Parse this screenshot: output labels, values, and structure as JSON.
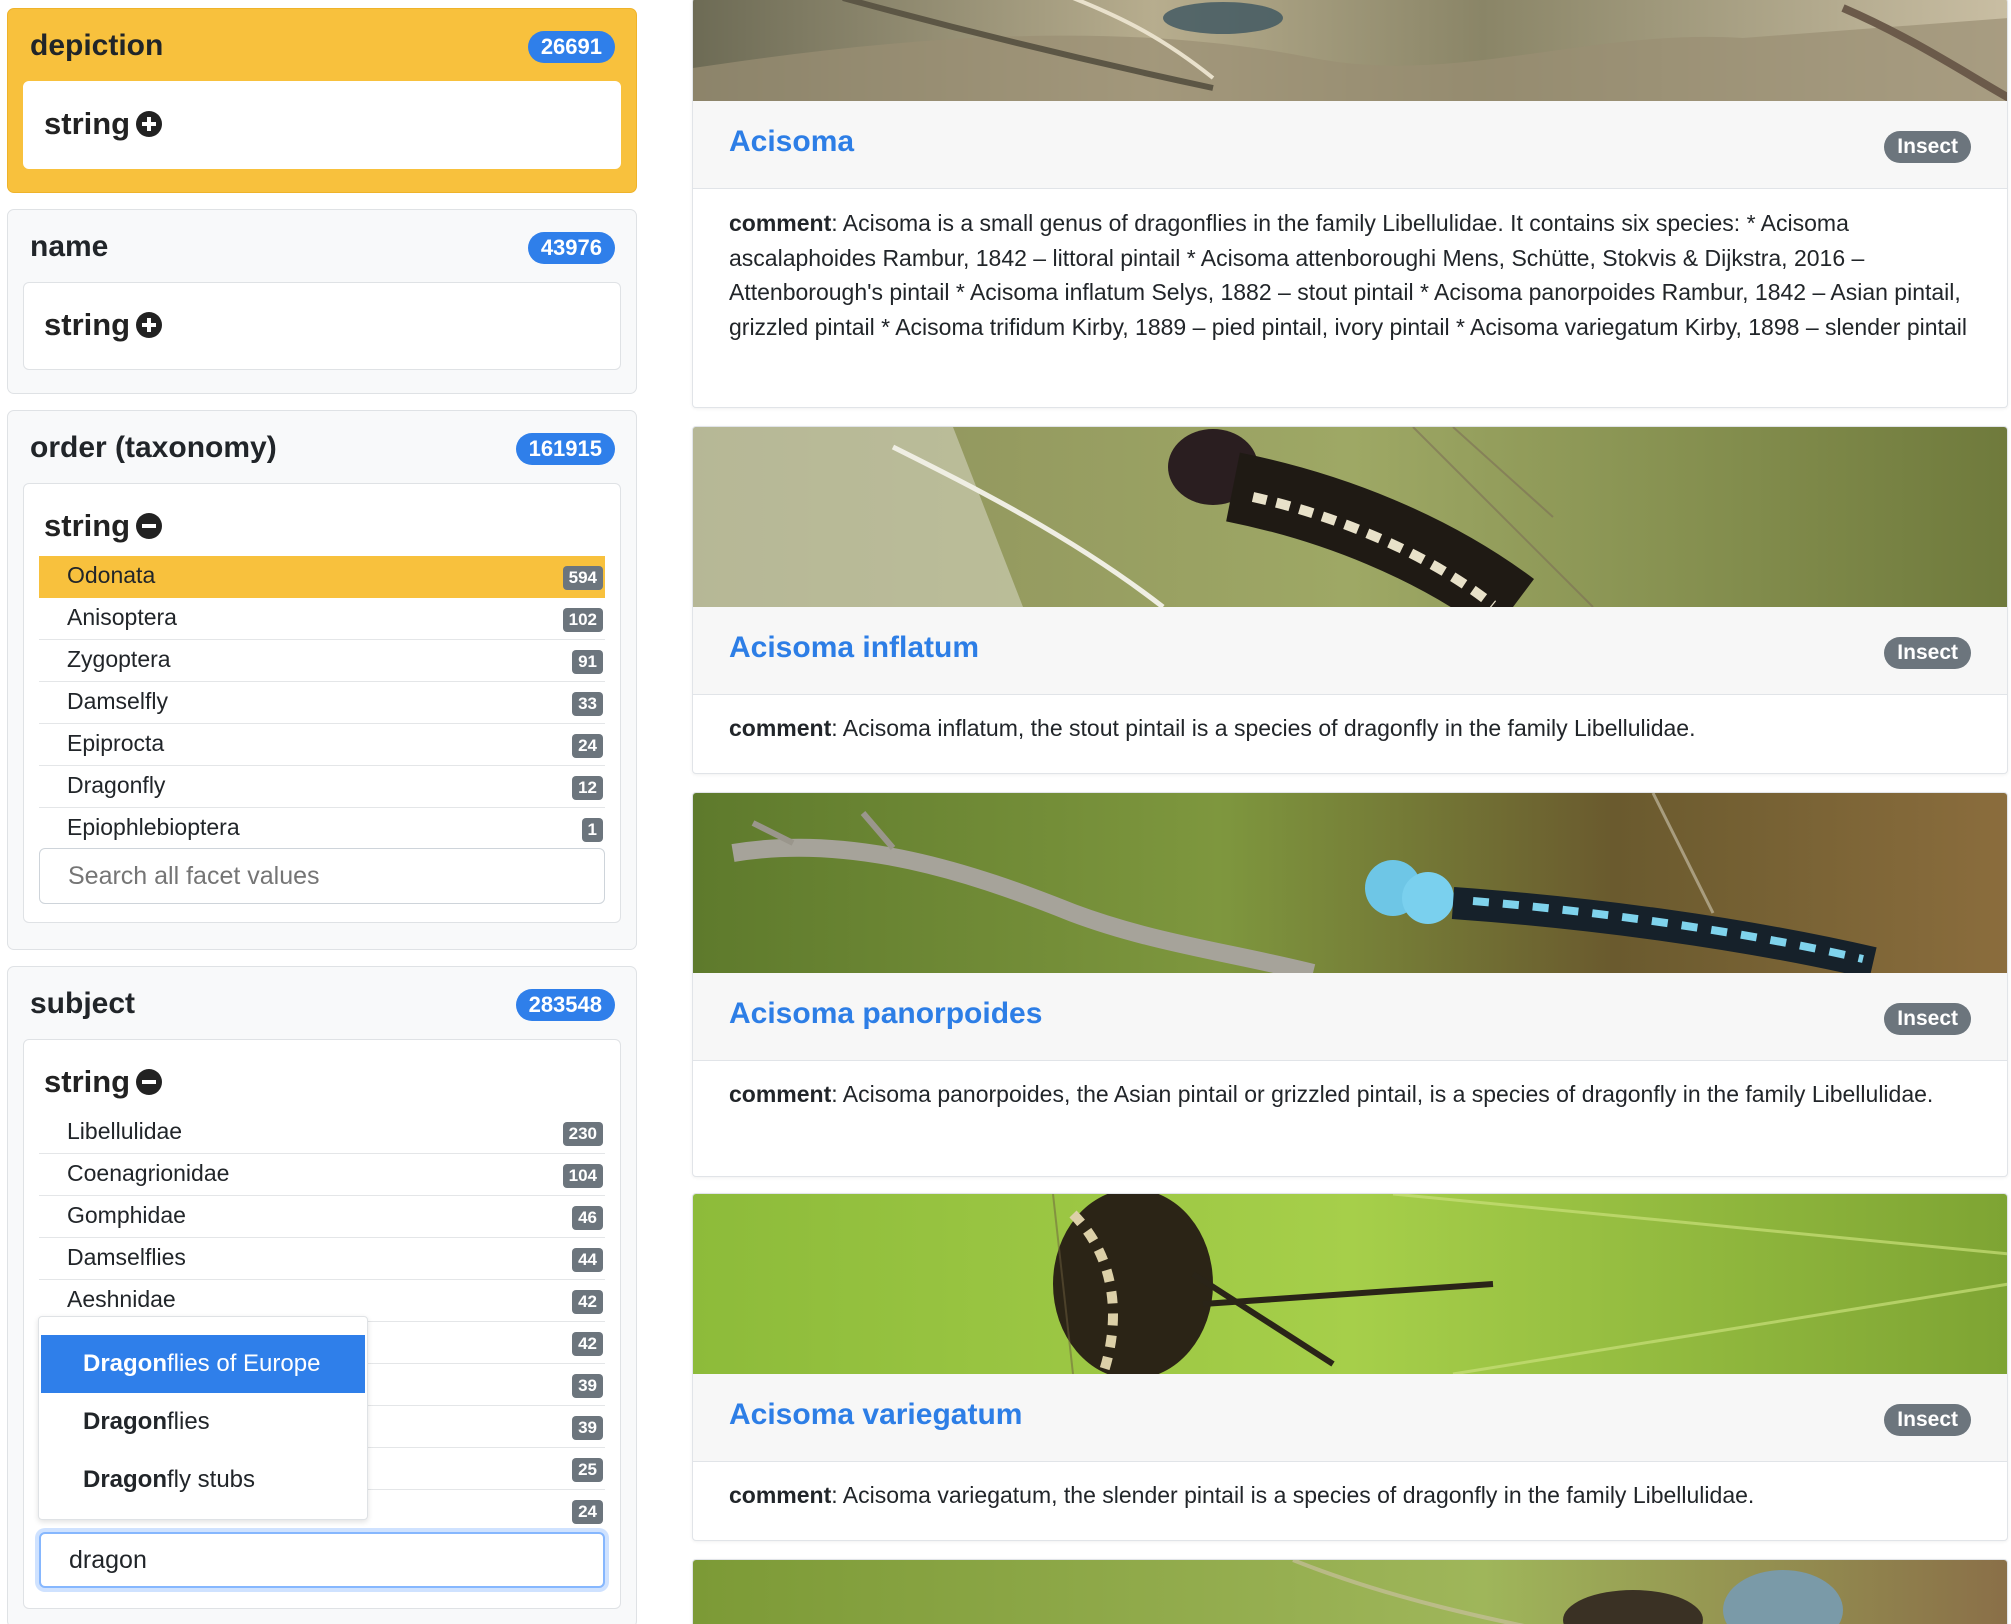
{
  "facets": [
    {
      "title": "depiction",
      "count": "26691",
      "type_label": "string",
      "type_icon": "plus-circle-icon"
    },
    {
      "title": "name",
      "count": "43976",
      "type_label": "string",
      "type_icon": "plus-circle-icon"
    },
    {
      "title": "order (taxonomy)",
      "count": "161915",
      "type_label": "string",
      "type_icon": "minus-circle-icon",
      "values": [
        {
          "label": "Odonata",
          "count": "594"
        },
        {
          "label": "Anisoptera",
          "count": "102"
        },
        {
          "label": "Zygoptera",
          "count": "91"
        },
        {
          "label": "Damselfly",
          "count": "33"
        },
        {
          "label": "Epiprocta",
          "count": "24"
        },
        {
          "label": "Dragonfly",
          "count": "12"
        },
        {
          "label": "Epiophlebioptera",
          "count": "1"
        }
      ],
      "search_placeholder": "Search all facet values"
    },
    {
      "title": "subject",
      "count": "283548",
      "type_label": "string",
      "type_icon": "minus-circle-icon",
      "values": [
        {
          "label": "Libellulidae",
          "count": "230"
        },
        {
          "label": "Coenagrionidae",
          "count": "104"
        },
        {
          "label": "Gomphidae",
          "count": "46"
        },
        {
          "label": "Damselflies",
          "count": "44"
        },
        {
          "label": "Aeshnidae",
          "count": "42"
        },
        {
          "label": "",
          "count": "42"
        },
        {
          "label": "",
          "count": "39"
        },
        {
          "label": "",
          "count": "39"
        },
        {
          "label": "",
          "count": "25"
        },
        {
          "label": "",
          "count": "24"
        }
      ],
      "search_value": "dragon",
      "autocomplete": [
        {
          "match": "Dragon",
          "rest": "flies of Europe"
        },
        {
          "match": "Dragon",
          "rest": "flies"
        },
        {
          "match": "Dragon",
          "rest": "fly stubs"
        }
      ]
    }
  ],
  "results": [
    {
      "title": "Acisoma",
      "badge": "Insect",
      "comment_key": "comment",
      "comment": ": Acisoma is a small genus of dragonflies in the family Libellulidae. It contains six species: * Acisoma ascalaphoides Rambur, 1842 – littoral pintail * Acisoma attenboroughi Mens, Schütte, Stokvis & Dijkstra, 2016 – Attenborough's pintail * Acisoma inflatum Selys, 1882 – stout pintail * Acisoma panorpoides Rambur, 1842 – Asian pintail, grizzled pintail * Acisoma trifidum Kirby, 1889 – pied pintail, ivory pintail * Acisoma variegatum Kirby, 1898 – slender pintail"
    },
    {
      "title": "Acisoma inflatum",
      "badge": "Insect",
      "comment_key": "comment",
      "comment": ": Acisoma inflatum, the stout pintail is a species of dragonfly in the family Libellulidae."
    },
    {
      "title": "Acisoma panorpoides",
      "badge": "Insect",
      "comment_key": "comment",
      "comment": ": Acisoma panorpoides, the Asian pintail or grizzled pintail, is a species of dragonfly in the family Libellulidae."
    },
    {
      "title": "Acisoma variegatum",
      "badge": "Insect",
      "comment_key": "comment",
      "comment": ": Acisoma variegatum, the slender pintail is a species of dragonfly in the family Libellulidae."
    }
  ],
  "colors": {
    "accent": "#f8c13d",
    "link": "#2d7ee6",
    "count_badge": "#2f7fea",
    "value_badge": "#6c757d"
  }
}
